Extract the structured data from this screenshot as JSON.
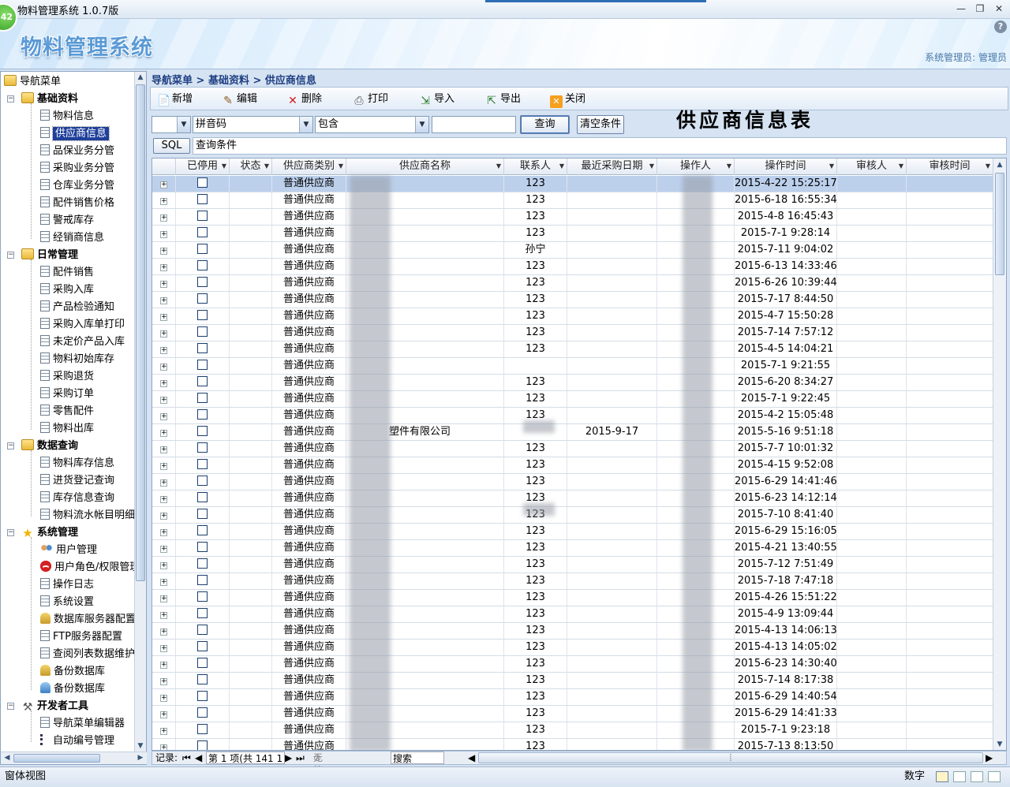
{
  "window": {
    "title": "物料管理系统 1.0.7版",
    "badge": "42"
  },
  "banner": {
    "logo": "物料管理系统",
    "user": "系统管理员: 管理员",
    "help": "?"
  },
  "nav": {
    "root": "导航菜单",
    "groups": [
      {
        "label": "基础资料",
        "items": [
          "物料信息",
          "供应商信息",
          "品保业务分管",
          "采购业务分管",
          "仓库业务分管",
          "配件销售价格",
          "警戒库存",
          "经销商信息"
        ]
      },
      {
        "label": "日常管理",
        "items": [
          "配件销售",
          "采购入库",
          "产品检验通知",
          "采购入库单打印",
          "未定价产品入库",
          "物料初始库存",
          "采购退货",
          "采购订单",
          "零售配件",
          "物料出库"
        ]
      },
      {
        "label": "数据查询",
        "items": [
          "物料库存信息",
          "进货登记查询",
          "库存信息查询",
          "物料流水帐目明细"
        ]
      },
      {
        "label": "系统管理",
        "items": [
          "用户管理",
          "用户角色/权限管理",
          "操作日志",
          "系统设置",
          "数据库服务器配置",
          "FTP服务器配置",
          "查阅列表数据维护",
          "备份数据库",
          "备份数据库"
        ]
      },
      {
        "label": "开发者工具",
        "items": [
          "导航菜单编辑器",
          "自动编号管理"
        ]
      }
    ],
    "selected": "供应商信息"
  },
  "breadcrumb": "导航菜单 > 基础资料 > 供应商信息",
  "toolbar": {
    "add": "新增",
    "edit": "编辑",
    "delete": "删除",
    "print": "打印",
    "import": "导入",
    "export": "导出",
    "close": "关闭"
  },
  "sheet_title": "供应商信息表",
  "filters": {
    "field1": "",
    "field2": "拼音码",
    "op": "包含",
    "value": "",
    "query": "查询",
    "clear": "清空条件"
  },
  "sql": {
    "button": "SQL",
    "text": "查询条件"
  },
  "grid": {
    "columns": [
      "已停用",
      "状态",
      "供应商类别",
      "供应商名称",
      "联系人",
      "最近采购日期",
      "操作人",
      "操作时间",
      "审核人",
      "审核时间"
    ],
    "rows": [
      {
        "cat": "普通供应商",
        "name": "",
        "contact": "123",
        "date": "",
        "time": "2015-4-22 15:25:17"
      },
      {
        "cat": "普通供应商",
        "name": "",
        "contact": "123",
        "date": "",
        "time": "2015-6-18 16:55:34"
      },
      {
        "cat": "普通供应商",
        "name": "",
        "contact": "123",
        "date": "",
        "time": "2015-4-8 16:45:43"
      },
      {
        "cat": "普通供应商",
        "name": "",
        "contact": "123",
        "date": "",
        "time": "2015-7-1 9:28:14"
      },
      {
        "cat": "普通供应商",
        "name": "",
        "contact": "孙宁",
        "date": "",
        "time": "2015-7-11 9:04:02"
      },
      {
        "cat": "普通供应商",
        "name": "",
        "contact": "123",
        "date": "",
        "time": "2015-6-13 14:33:46"
      },
      {
        "cat": "普通供应商",
        "name": "",
        "contact": "123",
        "date": "",
        "time": "2015-6-26 10:39:44"
      },
      {
        "cat": "普通供应商",
        "name": "",
        "contact": "123",
        "date": "",
        "time": "2015-7-17 8:44:50"
      },
      {
        "cat": "普通供应商",
        "name": "",
        "contact": "123",
        "date": "",
        "time": "2015-4-7 15:50:28"
      },
      {
        "cat": "普通供应商",
        "name": "",
        "contact": "123",
        "date": "",
        "time": "2015-7-14 7:57:12"
      },
      {
        "cat": "普通供应商",
        "name": "",
        "contact": "123",
        "date": "",
        "time": "2015-4-5 14:04:21"
      },
      {
        "cat": "普通供应商",
        "name": "",
        "contact": "",
        "date": "",
        "time": "2015-7-1 9:21:55"
      },
      {
        "cat": "普通供应商",
        "name": "",
        "contact": "123",
        "date": "",
        "time": "2015-6-20 8:34:27"
      },
      {
        "cat": "普通供应商",
        "name": "",
        "contact": "123",
        "date": "",
        "time": "2015-7-1 9:22:45"
      },
      {
        "cat": "普通供应商",
        "name": "",
        "contact": "123",
        "date": "",
        "time": "2015-4-2 15:05:48"
      },
      {
        "cat": "普通供应商",
        "name": "塑件有限公司",
        "contact": "",
        "date": "2015-9-17",
        "time": "2015-5-16 9:51:18"
      },
      {
        "cat": "普通供应商",
        "name": "",
        "contact": "123",
        "date": "",
        "time": "2015-7-7 10:01:32"
      },
      {
        "cat": "普通供应商",
        "name": "",
        "contact": "123",
        "date": "",
        "time": "2015-4-15 9:52:08"
      },
      {
        "cat": "普通供应商",
        "name": "",
        "contact": "123",
        "date": "",
        "time": "2015-6-29 14:41:46"
      },
      {
        "cat": "普通供应商",
        "name": "",
        "contact": "123",
        "date": "",
        "time": "2015-6-23 14:12:14"
      },
      {
        "cat": "普通供应商",
        "name": "",
        "contact": "123",
        "date": "",
        "time": "2015-7-10 8:41:40"
      },
      {
        "cat": "普通供应商",
        "name": "",
        "contact": "123",
        "date": "",
        "time": "2015-6-29 15:16:05"
      },
      {
        "cat": "普通供应商",
        "name": "",
        "contact": "123",
        "date": "",
        "time": "2015-4-21 13:40:55"
      },
      {
        "cat": "普通供应商",
        "name": "",
        "contact": "123",
        "date": "",
        "time": "2015-7-12 7:51:49"
      },
      {
        "cat": "普通供应商",
        "name": "",
        "contact": "123",
        "date": "",
        "time": "2015-7-18 7:47:18"
      },
      {
        "cat": "普通供应商",
        "name": "",
        "contact": "123",
        "date": "",
        "time": "2015-4-26 15:51:22"
      },
      {
        "cat": "普通供应商",
        "name": "",
        "contact": "123",
        "date": "",
        "time": "2015-4-9 13:09:44"
      },
      {
        "cat": "普通供应商",
        "name": "",
        "contact": "123",
        "date": "",
        "time": "2015-4-13 14:06:13"
      },
      {
        "cat": "普通供应商",
        "name": "",
        "contact": "123",
        "date": "",
        "time": "2015-4-13 14:05:02"
      },
      {
        "cat": "普通供应商",
        "name": "",
        "contact": "123",
        "date": "",
        "time": "2015-6-23 14:30:40"
      },
      {
        "cat": "普通供应商",
        "name": "",
        "contact": "123",
        "date": "",
        "time": "2015-7-14 8:17:38"
      },
      {
        "cat": "普通供应商",
        "name": "",
        "contact": "123",
        "date": "",
        "time": "2015-6-29 14:40:54"
      },
      {
        "cat": "普通供应商",
        "name": "",
        "contact": "123",
        "date": "",
        "time": "2015-6-29 14:41:33"
      },
      {
        "cat": "普通供应商",
        "name": "",
        "contact": "123",
        "date": "",
        "time": "2015-7-1 9:23:18"
      },
      {
        "cat": "普通供应商",
        "name": "",
        "contact": "123",
        "date": "",
        "time": "2015-7-13 8:13:50"
      }
    ]
  },
  "navigator": {
    "records_label": "记录:",
    "position": "第 1 项(共 141 1",
    "filter": "无筛选器",
    "search": "搜索"
  },
  "statusbar": {
    "left": "窗体视图",
    "mode": "数字"
  }
}
